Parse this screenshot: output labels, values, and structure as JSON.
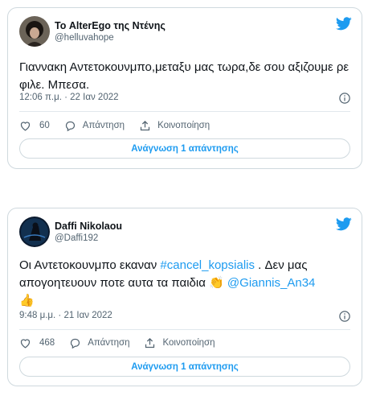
{
  "tweets": [
    {
      "author_name": "Το AlterEgo της Ντένης",
      "handle": "@helluvahope",
      "text_parts": [
        "Γιαννακη Αντετοκουνμπο,μεταξυ μας τωρα,δε σου αξιζουμε ρε φιλε. Μπεσα."
      ],
      "timestamp": "12:06 π.μ. · 22 Ιαν 2022",
      "likes": "60",
      "reply_label": "Απάντηση",
      "share_label": "Κοινοποίηση",
      "read_replies_label": "Ανάγνωση 1 απάντησης",
      "avatar_icon": "profile-photo-dark-hair"
    },
    {
      "author_name": "Daffi Nikolaou",
      "handle": "@Daffi192",
      "text_before": "Οι Αντετοκουνμπο εκαναν ",
      "hashtag": "#cancel_kopsialis",
      "text_middle": " . Δεν μας απογοητευουν ποτε αυτα τα παιδια ",
      "emoji1": "👏",
      "mention": "@Giannis_An34",
      "emoji2": "👍",
      "timestamp": "9:48 μ.μ. · 21 Ιαν 2022",
      "likes": "468",
      "reply_label": "Απάντηση",
      "share_label": "Κοινοποίηση",
      "read_replies_label": "Ανάγνωση 1 απάντησης",
      "avatar_icon": "profile-photo-dark-blue-figure"
    }
  ],
  "colors": {
    "accent": "#1d9bf0",
    "text": "#0f1419",
    "secondary": "#536471",
    "border": "#cfd9de"
  },
  "icons": [
    "twitter-bird-icon",
    "heart-icon",
    "reply-bubble-icon",
    "share-icon",
    "info-icon"
  ]
}
